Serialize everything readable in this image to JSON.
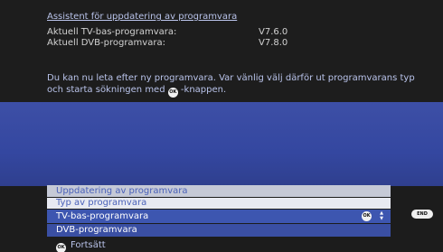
{
  "header": {
    "title": "Assistent för uppdatering av programvara",
    "tv_label": "Aktuell TV-bas-programvara:",
    "tv_version": "V7.6.0",
    "dvb_label": "Aktuell DVB-programvara:",
    "dvb_version": "V7.8.0"
  },
  "info": {
    "text_before": "Du kan nu leta efter ny programvara. Var vänlig välj därför ut programvarans typ och starta sökningen med ",
    "ok_label": "OK",
    "text_after": " -knappen."
  },
  "menu": {
    "title": "Uppdatering av programvara",
    "subtitle": "Typ av programvara",
    "items": [
      {
        "label": "TV-bas-programvara",
        "selected": true
      },
      {
        "label": "DVB-programvara",
        "selected": false
      }
    ],
    "ok_label": "OK"
  },
  "end_button": {
    "label": "END"
  },
  "footer": {
    "ok_label": "OK",
    "continue_label": "Fortsätt"
  },
  "colors": {
    "background": "#1c1c1c",
    "blue_band": "#3447a0",
    "header_text": "#b9c3ea",
    "menu_title_bg": "#c5c9d6",
    "menu_selected_bg": "#3d56b0"
  },
  "icons": {
    "ok": "ok-button-icon",
    "updown": "up-down-arrows-icon",
    "end": "end-button-icon"
  }
}
